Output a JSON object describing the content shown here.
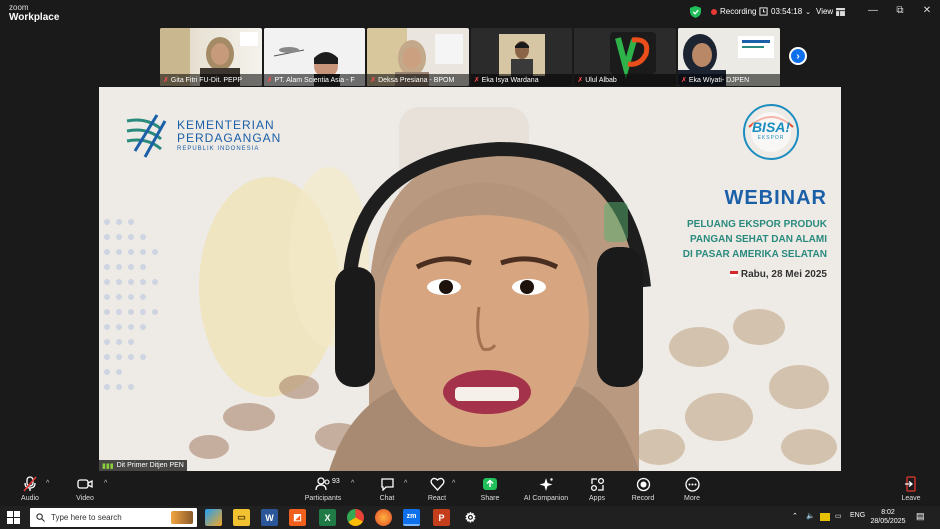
{
  "app": {
    "brand_line1": "zoom",
    "brand_line2": "Workplace",
    "recording_label": "Recording",
    "elapsed": "03:54:18",
    "view_label": "View",
    "minimize_glyph": "—",
    "maximize_glyph": "⧉",
    "close_glyph": "✕"
  },
  "participants_strip": [
    {
      "name": "Gita Fitri FU-Dit. PEPP",
      "muted": true
    },
    {
      "name": "PT. Alam Scientia Asia - F",
      "muted": true
    },
    {
      "name": "Deksa Presiana - BPOM",
      "muted": true
    },
    {
      "name": "Eka Isya Wardana",
      "muted": true
    },
    {
      "name": "Ulul Albab",
      "muted": true
    },
    {
      "name": "Eka Wiyati- DJPEN",
      "muted": true
    }
  ],
  "main_video": {
    "speaker_name": "Dit Primer Ditjen PEN",
    "slide": {
      "org_line1": "KEMENTERIAN",
      "org_line2": "PERDAGANGAN",
      "org_line3": "REPUBLIK INDONESIA",
      "badge_text": "BISA!",
      "badge_sub": "EKSPOR",
      "webinar_label": "WEBINAR",
      "topic_line1": "PELUANG EKSPOR PRODUK",
      "topic_line2": "PANGAN SEHAT DAN ALAMI",
      "topic_line3": "DI PASAR AMERIKA SELATAN",
      "date": "Rabu, 28 Mei 2025"
    }
  },
  "toolbar": {
    "audio": "Audio",
    "video": "Video",
    "participants": "Participants",
    "participants_count": "93",
    "chat": "Chat",
    "react": "React",
    "share": "Share",
    "ai_companion": "AI Companion",
    "apps": "Apps",
    "record": "Record",
    "more": "More",
    "leave": "Leave"
  },
  "taskbar": {
    "search_placeholder": "Type here to search",
    "language": "ENG",
    "time": "8:02",
    "date": "28/05/2025"
  },
  "colors": {
    "accent_blue": "#0e71eb",
    "recording_red": "#e53935",
    "share_green": "#21c05b",
    "slide_blue": "#1b5fa8",
    "slide_teal": "#2a8a7e"
  }
}
